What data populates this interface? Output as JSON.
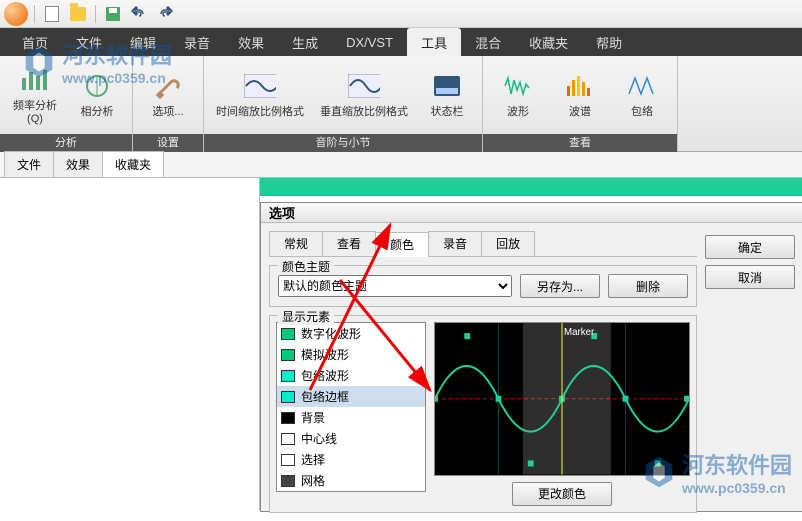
{
  "qat_icons": [
    "app-orb",
    "new-doc",
    "open-folder",
    "save",
    "undo",
    "redo"
  ],
  "ribbon_tabs": [
    "首页",
    "文件",
    "编辑",
    "录音",
    "效果",
    "生成",
    "DX/VST",
    "工具",
    "混合",
    "收藏夹",
    "帮助"
  ],
  "ribbon_selected": "工具",
  "ribbon_groups": {
    "analysis": {
      "label": "分析",
      "btns": [
        "频率分析(Q)",
        "相分析"
      ]
    },
    "settings": {
      "label": "设置",
      "btns": [
        "选项..."
      ]
    },
    "scale": {
      "label": "音阶与小节",
      "btns": [
        "时间缩放比例格式",
        "垂直缩放比例格式",
        "状态栏"
      ]
    },
    "view": {
      "label": "查看",
      "btns": [
        "波形",
        "波谱",
        "包络"
      ]
    }
  },
  "file_tabs": [
    "文件",
    "效果",
    "收藏夹"
  ],
  "file_tab_selected": "收藏夹",
  "dialog": {
    "title": "选项",
    "tabs": [
      "常规",
      "查看",
      "颜色",
      "录音",
      "回放"
    ],
    "selected_tab": "颜色",
    "ok": "确定",
    "cancel": "取消",
    "theme_label": "颜色主题",
    "theme_value": "默认的颜色主题",
    "save_as": "另存为...",
    "delete": "删除",
    "display_label": "显示元素",
    "items": [
      {
        "label": "数字化波形",
        "color": "#00c97a"
      },
      {
        "label": "模拟波形",
        "color": "#00c97a"
      },
      {
        "label": "包络波形",
        "color": "#00eec9"
      },
      {
        "label": "包络边框",
        "color": "#00eec9"
      },
      {
        "label": "背景",
        "color": "#000000"
      },
      {
        "label": "中心线",
        "color": "#ffffff"
      },
      {
        "label": "选择",
        "color": "#ffffff"
      },
      {
        "label": "网格",
        "color": "#444444"
      }
    ],
    "change_color": "更改颜色",
    "preview_marker": "Marker"
  },
  "watermark": {
    "line1": "河东软件园",
    "line2": "www.pc0359.cn"
  }
}
